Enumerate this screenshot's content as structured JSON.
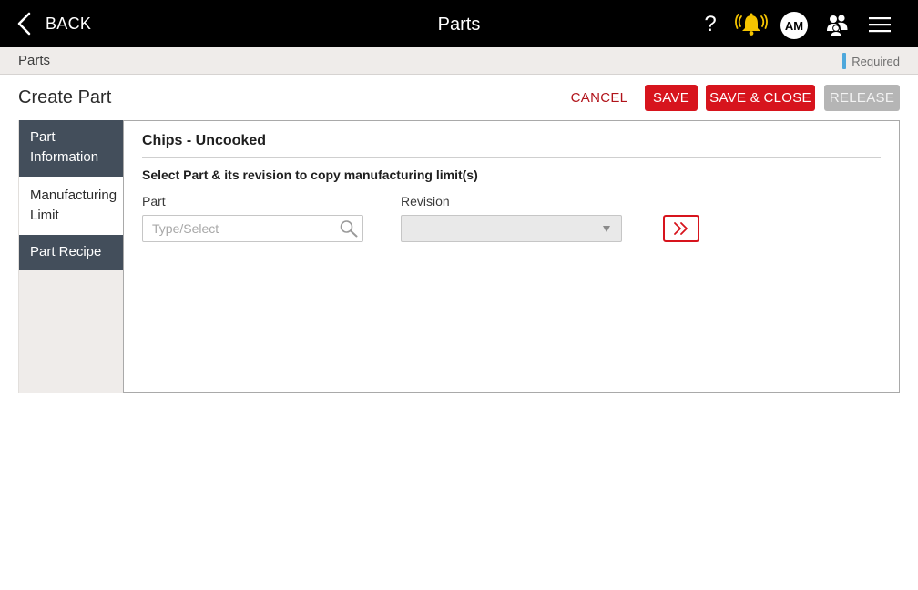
{
  "topbar": {
    "back_label": "BACK",
    "title": "Parts",
    "help_label": "?",
    "avatar_initials": "AM",
    "accent_color": "#f5c400"
  },
  "breadcrumb": {
    "current": "Parts",
    "required_label": "Required",
    "required_color": "#4ea8dc"
  },
  "page": {
    "title": "Create Part",
    "actions": {
      "cancel": "CANCEL",
      "save": "SAVE",
      "save_close": "SAVE & CLOSE",
      "release": "RELEASE"
    },
    "primary_color": "#d7141d"
  },
  "sidebar": {
    "items": [
      {
        "label": "Part Information",
        "active": false
      },
      {
        "label": "Manufacturing Limit",
        "active": true
      },
      {
        "label": "Part Recipe",
        "active": false
      }
    ]
  },
  "main": {
    "section_title": "Chips - Uncooked",
    "instruction": "Select Part & its revision to copy manufacturing limit(s)",
    "part_label": "Part",
    "part_placeholder": "Type/Select",
    "part_value": "",
    "revision_label": "Revision",
    "revision_value": ""
  }
}
